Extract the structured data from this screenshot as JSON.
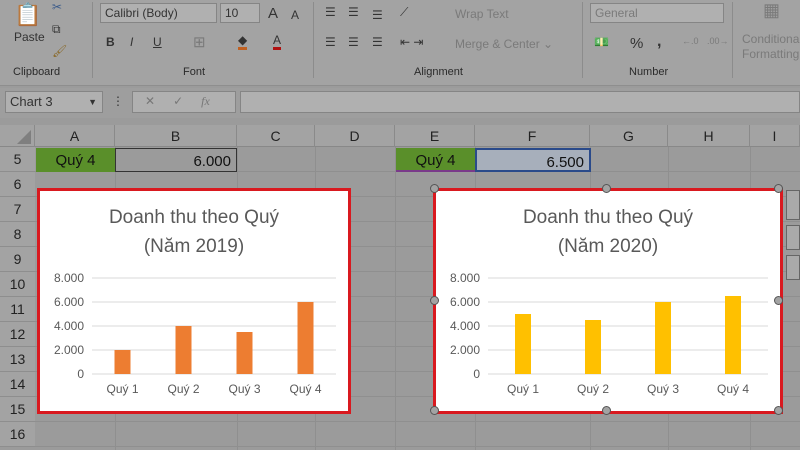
{
  "ribbon": {
    "clipboard": {
      "paste": "Paste",
      "label": "Clipboard"
    },
    "font": {
      "name": "Calibri (Body)",
      "size": "10",
      "bold": "B",
      "italic": "I",
      "underline": "U",
      "label": "Font"
    },
    "alignment": {
      "wrap": "Wrap Text",
      "merge": "Merge & Center",
      "label": "Alignment"
    },
    "number": {
      "format": "General",
      "percent": "%",
      "comma": ",",
      "label": "Number"
    },
    "styles": {
      "conditional": "Conditional",
      "formatting": "Formatting"
    }
  },
  "formula_bar": {
    "name_box": "Chart 3",
    "fx": "fx",
    "value": ""
  },
  "columns": [
    "A",
    "B",
    "C",
    "D",
    "E",
    "F",
    "G",
    "H",
    "I"
  ],
  "rows": [
    "5",
    "6",
    "7",
    "8",
    "9",
    "10",
    "11",
    "12",
    "13",
    "14",
    "15",
    "16"
  ],
  "cells": {
    "A5": "Quý 4",
    "B5": "6.000",
    "E5": "Quý 4",
    "F5": "6.500"
  },
  "chart_data": [
    {
      "type": "bar",
      "title": "Doanh thu theo Quý",
      "subtitle": "(Năm 2019)",
      "categories": [
        "Quý 1",
        "Quý 2",
        "Quý 3",
        "Quý 4"
      ],
      "values": [
        2000,
        4000,
        3500,
        6000
      ],
      "ylim": [
        0,
        8000
      ],
      "yticks": [
        "0",
        "2.000",
        "4.000",
        "6.000",
        "8.000"
      ],
      "color": "#ed7d31",
      "grid": true
    },
    {
      "type": "bar",
      "title": "Doanh thu theo Quý",
      "subtitle": "(Năm 2020)",
      "categories": [
        "Quý 1",
        "Quý 2",
        "Quý 3",
        "Quý 4"
      ],
      "values": [
        5000,
        4500,
        6000,
        6500
      ],
      "ylim": [
        0,
        8000
      ],
      "yticks": [
        "0",
        "2.000",
        "4.000",
        "6.000",
        "8.000"
      ],
      "color": "#ffc000",
      "grid": true
    }
  ]
}
